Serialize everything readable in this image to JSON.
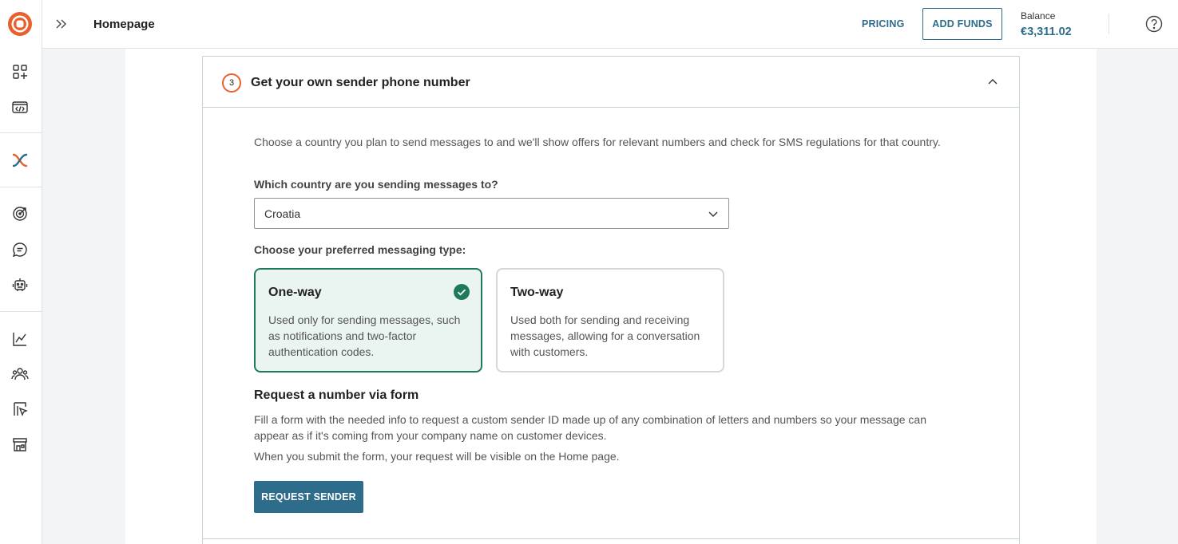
{
  "header": {
    "page_title": "Homepage",
    "pricing_label": "PRICING",
    "add_funds_label": "ADD FUNDS",
    "balance_label": "Balance",
    "balance_value": "€3,311.02"
  },
  "sidebar": {
    "items": [
      {
        "icon": "apps-add-icon"
      },
      {
        "icon": "code-window-icon"
      },
      {
        "icon": "exchange-logo-icon"
      },
      {
        "icon": "target-icon"
      },
      {
        "icon": "chat-icon"
      },
      {
        "icon": "robot-icon"
      },
      {
        "icon": "analytics-chart-icon"
      },
      {
        "icon": "people-icon"
      },
      {
        "icon": "campaign-pointer-icon"
      },
      {
        "icon": "store-icon"
      }
    ]
  },
  "section": {
    "step_number": "3",
    "title": "Get your own sender phone number",
    "description": "Choose a country you plan to send messages to and we'll show offers for relevant numbers and check for SMS regulations for that country.",
    "country_label": "Which country are you sending messages to?",
    "country_value": "Croatia",
    "messaging_type_label": "Choose your preferred messaging type:",
    "options": [
      {
        "title": "One-way",
        "text": "Used only for sending messages, such as notifications and two-factor authentication codes.",
        "selected": true
      },
      {
        "title": "Two-way",
        "text": "Used both for sending and receiving messages, allowing for a conversation with customers.",
        "selected": false
      }
    ],
    "request_title": "Request a number via form",
    "request_description": "Fill a form with the needed info to request a custom sender ID made up of any combination of letters and numbers so your message can appear as if it's coming from your company name on customer devices.",
    "request_note": "When you submit the form, your request will be visible on the Home page.",
    "request_button": "REQUEST SENDER"
  },
  "colors": {
    "accent": "#2e6c8c",
    "brand_orange": "#e8612c",
    "selected_green": "#1f7a5c"
  }
}
